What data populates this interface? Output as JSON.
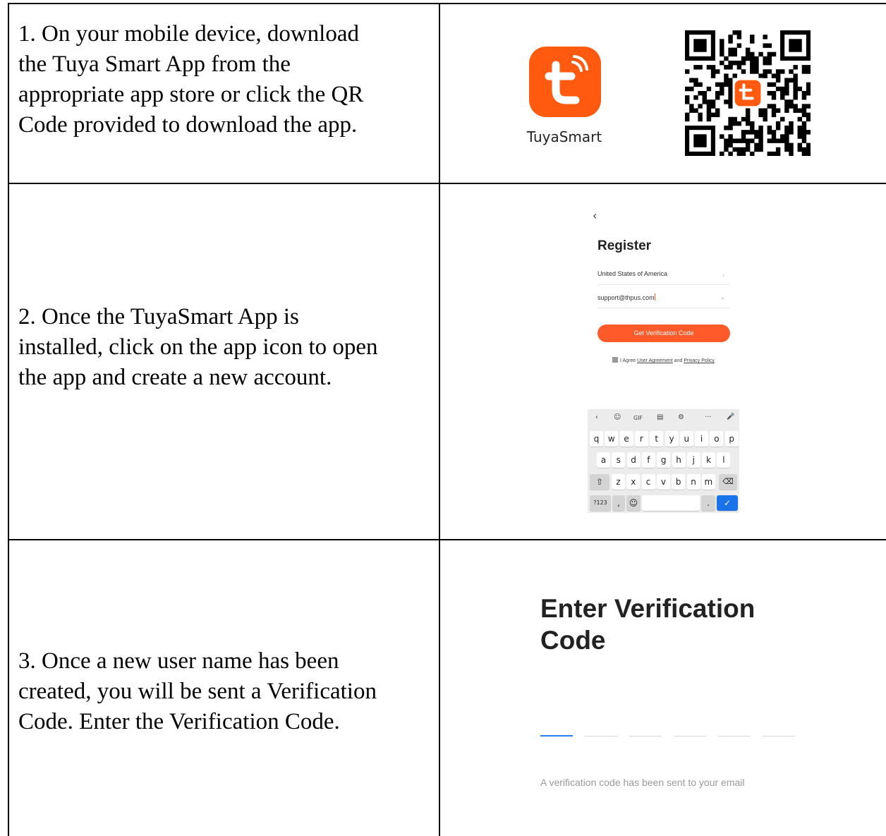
{
  "steps": [
    {
      "text_lines": [
        "1. On your mobile device, download",
        "the Tuya Smart App from the",
        "appropriate app store or click the QR",
        "Code provided to download the app."
      ]
    },
    {
      "text_lines": [
        "2. Once the TuyaSmart App is",
        "installed, click on the app icon to open",
        "the app and create a new account."
      ]
    },
    {
      "text_lines": [
        "3. Once a new user name has been",
        "created, you will be sent a Verification",
        "Code.  Enter the Verification Code."
      ]
    }
  ],
  "app": {
    "name": "TuyaSmart",
    "icon": "tuya-logo-icon",
    "brand_color": "#ff5a10"
  },
  "qr": {
    "icon": "qr-code-icon",
    "center_icon": "tuya-logo-icon"
  },
  "register": {
    "back": "‹",
    "title": "Register",
    "country": "United States of America",
    "country_chevron": "›",
    "email": "support@thpus.com",
    "clear": "×",
    "button": "Get Verification Code",
    "agree_prefix": "I Agree ",
    "user_agreement": "User Agreement",
    "and": " and ",
    "privacy_policy": "Privacy Policy",
    "button_color": "#ff5a2a"
  },
  "keyboard": {
    "toolbar": [
      "‹",
      "☺",
      "GIF",
      "▤",
      "⚙",
      "···",
      "🎤"
    ],
    "row1": [
      "q",
      "w",
      "e",
      "r",
      "t",
      "y",
      "u",
      "i",
      "o",
      "p"
    ],
    "row2": [
      "a",
      "s",
      "d",
      "f",
      "g",
      "h",
      "j",
      "k",
      "l"
    ],
    "row3": [
      "z",
      "x",
      "c",
      "v",
      "b",
      "n",
      "m"
    ],
    "shift": "⇧",
    "backspace": "⌫",
    "symbols": "?123",
    "comma": ",",
    "emoji": "☺",
    "period": ".",
    "done": "✓",
    "accent_color": "#1a73e8"
  },
  "verify": {
    "title_line1": "Enter Verification",
    "title_line2": "Code",
    "hint": "A verification code has been sent to your email",
    "active_color": "#2d7df0"
  }
}
